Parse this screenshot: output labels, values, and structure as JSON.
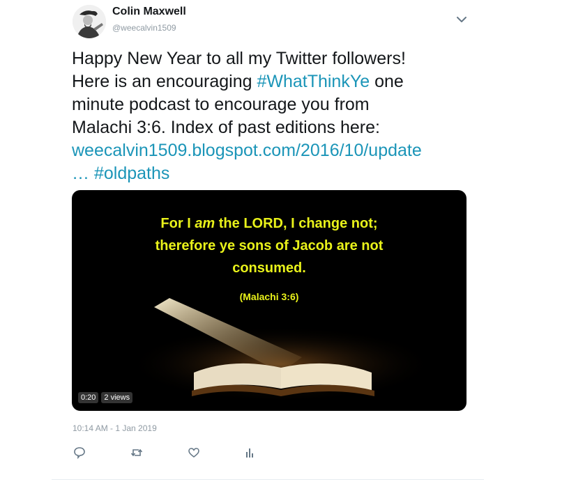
{
  "tweet": {
    "author": {
      "display_name": "Colin Maxwell",
      "handle": "@weecalvin1509"
    },
    "text": {
      "line1": "Happy New Year to all my Twitter followers!",
      "line2_pre": "Here is an encouraging ",
      "hashtag1": "#WhatThinkYe",
      "line2_post": " one",
      "line3": "minute podcast to encourage you from",
      "line4": "Malachi 3:6. Index of past editions here:",
      "link": "weecalvin1509.blogspot.com/2016/10/update",
      "ellipsis": "…",
      "hashtag2": "#oldpaths"
    },
    "media": {
      "verse_pre": "For I ",
      "verse_em": "am",
      "verse_post": " the LORD, I change not;",
      "verse_line2": "therefore ye sons of Jacob are not",
      "verse_line3": "consumed.",
      "reference": "(Malachi 3:6)",
      "duration": "0:20",
      "views": "2 views"
    },
    "timestamp": "10:14 AM - 1 Jan 2019",
    "actions": [
      "reply-icon",
      "retweet-icon",
      "like-icon",
      "analytics-icon"
    ],
    "colors": {
      "link": "#1b95b8",
      "verse": "#e9f21a",
      "secondary_text": "#8f9aa3"
    }
  }
}
